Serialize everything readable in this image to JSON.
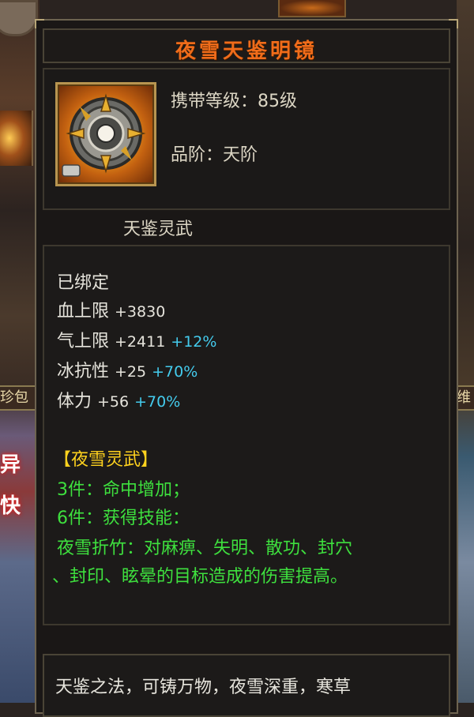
{
  "background": {
    "left_strip_text": "珍包",
    "right_strip_text": "维",
    "left_glyph_1": "异",
    "left_glyph_2": "快"
  },
  "tooltip": {
    "title": "夜雪天鉴明镜",
    "carry_level": "携带等级：85级",
    "grade": "品阶：天阶",
    "category": "天鉴灵武",
    "icon": "shield-mirror-icon"
  },
  "stats": {
    "bound": "已绑定",
    "hp_label": "血上限",
    "hp_value": "+3830",
    "qi_label": "气上限",
    "qi_value": "+2411",
    "qi_bonus": "+12%",
    "ice_label": "冰抗性",
    "ice_value": "+25",
    "ice_bonus": "+70%",
    "stamina_label": "体力",
    "stamina_value": "+56",
    "stamina_bonus": "+70%"
  },
  "set_bonus": {
    "name": "【夜雪灵武】",
    "piece3": "3件：命中增加；",
    "piece6": "6件：获得技能：",
    "skill_line1": "夜雪折竹：对麻痹、失明、散功、封穴",
    "skill_line2": "、封印、眩晕的目标造成的伤害提高。"
  },
  "description": {
    "text": "天鉴之法，可铸万物，夜雪深重，寒草"
  },
  "colors": {
    "title": "#f06c1a",
    "stat_white": "#e6e4dc",
    "bonus_cyan": "#44ccee",
    "set_name_yellow": "#ffd21e",
    "set_effect_green": "#3ee03e"
  }
}
